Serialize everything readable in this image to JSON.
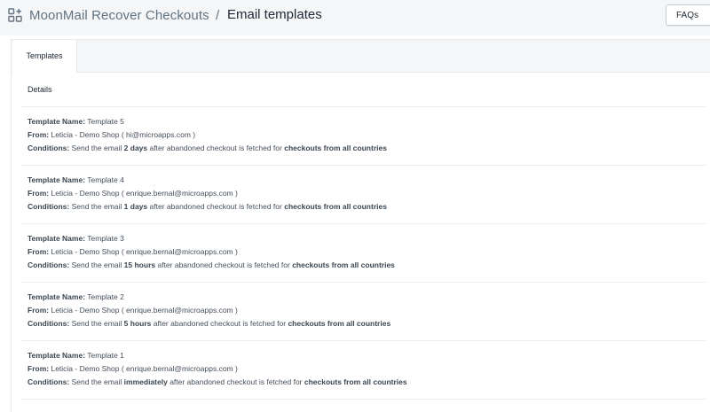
{
  "header": {
    "app_name": "MoonMail Recover Checkouts",
    "separator": "/",
    "page_title": "Email templates",
    "faqs_label": "FAQs"
  },
  "tabs": [
    {
      "label": "Templates",
      "active": true
    }
  ],
  "section": {
    "details_label": "Details"
  },
  "labels": {
    "template_name": "Template Name:",
    "from": "From:",
    "conditions": "Conditions:",
    "send_prefix": "Send the email",
    "after_text": "after abandoned checkout is fetched for",
    "target": "checkouts from all countries"
  },
  "templates": [
    {
      "name": "Template 5",
      "from": "Leticia - Demo Shop ( hi@microapps.com )",
      "delay": "2 days"
    },
    {
      "name": "Template 4",
      "from": "Leticia - Demo Shop ( enrique.bernal@microapps.com )",
      "delay": "1 days"
    },
    {
      "name": "Template 3",
      "from": "Leticia - Demo Shop ( enrique.bernal@microapps.com )",
      "delay": "15 hours"
    },
    {
      "name": "Template 2",
      "from": "Leticia - Demo Shop ( enrique.bernal@microapps.com )",
      "delay": "5 hours"
    },
    {
      "name": "Template 1",
      "from": "Leticia - Demo Shop ( enrique.bernal@microapps.com )",
      "delay": "immediately"
    }
  ],
  "colors": {
    "topbar_bg": "#f4f6f8",
    "text_primary": "#212b36",
    "text_secondary": "#637381"
  },
  "icons": {
    "app": "apps-add-icon"
  }
}
